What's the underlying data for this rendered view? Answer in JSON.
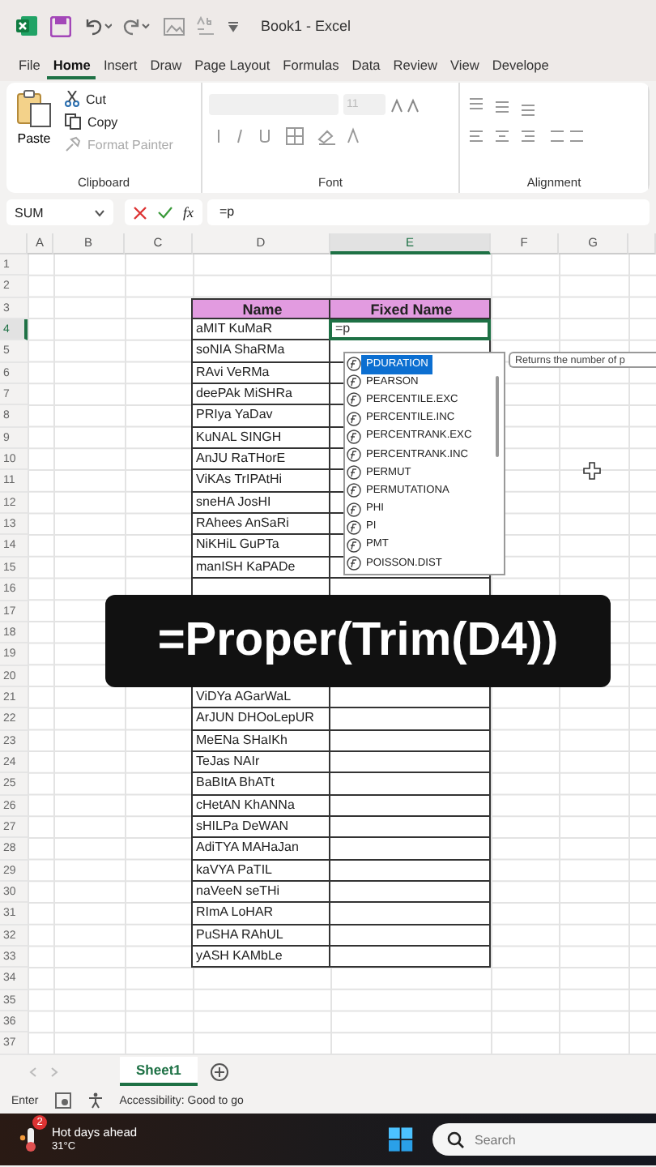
{
  "title_bar": {
    "title": "Book1  -  Excel"
  },
  "ribbon_tabs": [
    {
      "label": "File",
      "selected": false
    },
    {
      "label": "Home",
      "selected": true
    },
    {
      "label": "Insert",
      "selected": false
    },
    {
      "label": "Draw",
      "selected": false
    },
    {
      "label": "Page Layout",
      "selected": false
    },
    {
      "label": "Formulas",
      "selected": false
    },
    {
      "label": "Data",
      "selected": false
    },
    {
      "label": "Review",
      "selected": false
    },
    {
      "label": "View",
      "selected": false
    },
    {
      "label": "Develope",
      "selected": false
    }
  ],
  "ribbon": {
    "paste": "Paste",
    "cut": "Cut",
    "copy": "Copy",
    "format_painter": "Format Painter",
    "clipboard_label": "Clipboard",
    "font_size": "11",
    "font_label": "Font",
    "alignment_label": "Alignment"
  },
  "formula_bar": {
    "name_box": "SUM",
    "fx_label": "fx",
    "value": "=p"
  },
  "columns": [
    {
      "label": "A",
      "selected": false
    },
    {
      "label": "B",
      "selected": false
    },
    {
      "label": "C",
      "selected": false
    },
    {
      "label": "D",
      "selected": false
    },
    {
      "label": "E",
      "selected": true
    },
    {
      "label": "F",
      "selected": false
    },
    {
      "label": "G",
      "selected": false
    }
  ],
  "rows": [
    {
      "number": "1",
      "kind": "blank",
      "selected": false
    },
    {
      "number": "2",
      "kind": "blank",
      "selected": false
    },
    {
      "number": "3",
      "kind": "header",
      "selected": false,
      "name": "Name",
      "fixed": "Fixed Name"
    },
    {
      "number": "4",
      "kind": "data",
      "selected": true,
      "name": "aMIT KuMaR",
      "fixed": "=p"
    },
    {
      "number": "5",
      "kind": "data",
      "selected": false,
      "name": "soNIA ShaRMa"
    },
    {
      "number": "6",
      "kind": "data",
      "selected": false,
      "name": "RAvi VeRMa"
    },
    {
      "number": "7",
      "kind": "data",
      "selected": false,
      "name": "deePAk MiSHRa"
    },
    {
      "number": "8",
      "kind": "data",
      "selected": false,
      "name": "PRIya YaDav"
    },
    {
      "number": "9",
      "kind": "data",
      "selected": false,
      "name": "KuNAL SINGH"
    },
    {
      "number": "10",
      "kind": "data",
      "selected": false,
      "name": "AnJU RaTHorE"
    },
    {
      "number": "11",
      "kind": "data",
      "selected": false,
      "name": "ViKAs TrIPAtHi"
    },
    {
      "number": "12",
      "kind": "data",
      "selected": false,
      "name": "sneHA JosHI"
    },
    {
      "number": "13",
      "kind": "data",
      "selected": false,
      "name": "RAhees AnSaRi"
    },
    {
      "number": "14",
      "kind": "data",
      "selected": false,
      "name": "NiKHiL GuPTa"
    },
    {
      "number": "15",
      "kind": "data",
      "selected": false,
      "name": "manISH KaPADe"
    },
    {
      "number": "16",
      "kind": "data",
      "selected": false
    },
    {
      "number": "17",
      "kind": "data",
      "selected": false
    },
    {
      "number": "18",
      "kind": "data",
      "selected": false
    },
    {
      "number": "19",
      "kind": "data",
      "selected": false
    },
    {
      "number": "20",
      "kind": "data",
      "selected": false
    },
    {
      "number": "21",
      "kind": "data",
      "selected": false,
      "name": "ViDYa AGarWaL"
    },
    {
      "number": "22",
      "kind": "data",
      "selected": false,
      "name": "ArJUN DHOoLepUR"
    },
    {
      "number": "23",
      "kind": "data",
      "selected": false,
      "name": "MeENa SHaIKh"
    },
    {
      "number": "24",
      "kind": "data",
      "selected": false,
      "name": "TeJas NAIr"
    },
    {
      "number": "25",
      "kind": "data",
      "selected": false,
      "name": "BaBItA BhATt"
    },
    {
      "number": "26",
      "kind": "data",
      "selected": false,
      "name": "cHetAN KhANNa"
    },
    {
      "number": "27",
      "kind": "data",
      "selected": false,
      "name": "sHILPa DeWAN"
    },
    {
      "number": "28",
      "kind": "data",
      "selected": false,
      "name": "AdiTYA MAHaJan"
    },
    {
      "number": "29",
      "kind": "data",
      "selected": false,
      "name": "kaVYA PaTIL"
    },
    {
      "number": "30",
      "kind": "data",
      "selected": false,
      "name": "naVeeN seTHi"
    },
    {
      "number": "31",
      "kind": "data",
      "selected": false,
      "name": "RImA LoHAR"
    },
    {
      "number": "32",
      "kind": "data",
      "selected": false,
      "name": "PuSHA RAhUL"
    },
    {
      "number": "33",
      "kind": "data",
      "selected": false,
      "name": "yASH KAMbLe"
    },
    {
      "number": "34",
      "kind": "blank",
      "selected": false
    },
    {
      "number": "35",
      "kind": "blank",
      "selected": false
    },
    {
      "number": "36",
      "kind": "blank",
      "selected": false
    },
    {
      "number": "37",
      "kind": "blank",
      "selected": false
    }
  ],
  "autocomplete": {
    "items": [
      {
        "label": "PDURATION",
        "selected": true
      },
      {
        "label": "PEARSON",
        "selected": false
      },
      {
        "label": "PERCENTILE.EXC",
        "selected": false
      },
      {
        "label": "PERCENTILE.INC",
        "selected": false
      },
      {
        "label": "PERCENTRANK.EXC",
        "selected": false
      },
      {
        "label": "PERCENTRANK.INC",
        "selected": false
      },
      {
        "label": "PERMUT",
        "selected": false
      },
      {
        "label": "PERMUTATIONA",
        "selected": false
      },
      {
        "label": "PHI",
        "selected": false
      },
      {
        "label": "PI",
        "selected": false
      },
      {
        "label": "PMT",
        "selected": false
      },
      {
        "label": "POISSON.DIST",
        "selected": false
      }
    ],
    "tooltip": "Returns the number of p"
  },
  "caption": "=Proper(Trim(D4))",
  "sheet_tabs": [
    {
      "label": "Sheet1",
      "selected": true
    }
  ],
  "status_bar": {
    "mode": "Enter",
    "accessibility": "Accessibility: Good to go"
  },
  "taskbar": {
    "badge": "2",
    "weather_title": "Hot days ahead",
    "weather_temp": "31°C",
    "search_placeholder": "Search"
  }
}
